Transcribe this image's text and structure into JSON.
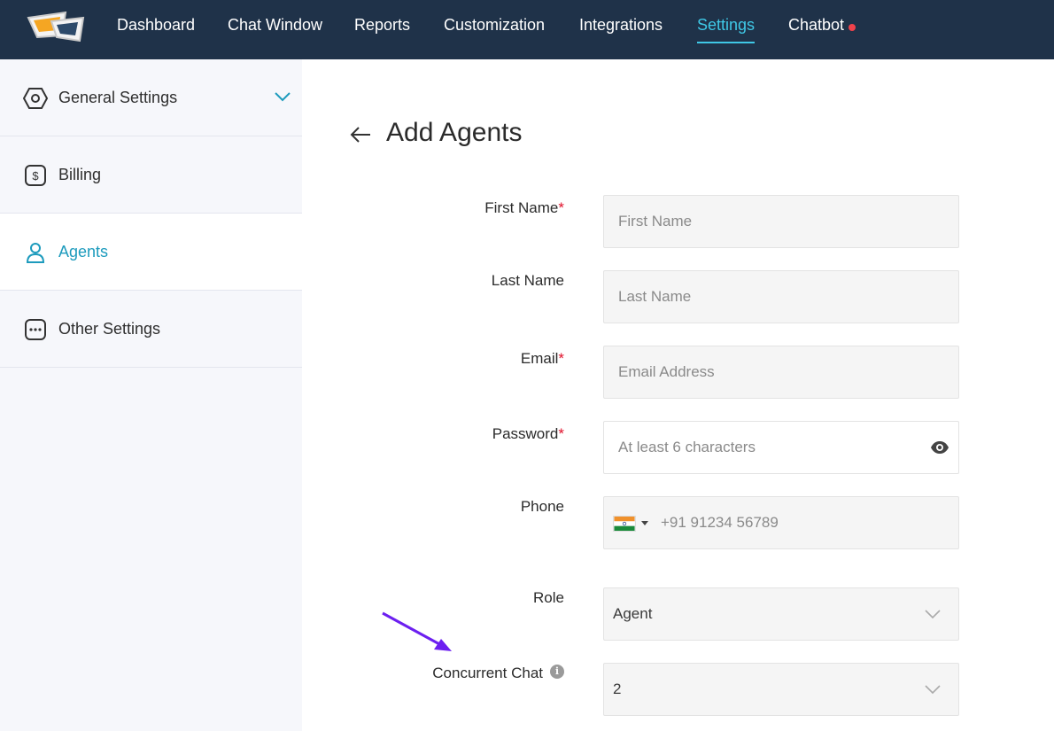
{
  "nav": {
    "items": [
      {
        "label": "Dashboard"
      },
      {
        "label": "Chat Window"
      },
      {
        "label": "Reports"
      },
      {
        "label": "Customization"
      },
      {
        "label": "Integrations"
      },
      {
        "label": "Settings",
        "active": true
      },
      {
        "label": "Chatbot",
        "notification_dot": true
      }
    ],
    "logo_icon": "chat-bubbles-logo"
  },
  "sidebar": {
    "items": [
      {
        "label": "General Settings",
        "icon": "hexagon-gear-icon",
        "expandable": true
      },
      {
        "label": "Billing",
        "icon": "dollar-icon"
      },
      {
        "label": "Agents",
        "icon": "user-icon",
        "active": true
      },
      {
        "label": "Other Settings",
        "icon": "more-dots-icon"
      }
    ]
  },
  "page": {
    "title": "Add Agents"
  },
  "form": {
    "first_name": {
      "label": "First Name",
      "required_mark": "*",
      "placeholder": "First Name"
    },
    "last_name": {
      "label": "Last Name",
      "placeholder": "Last Name"
    },
    "email": {
      "label": "Email",
      "required_mark": "*",
      "placeholder": "Email Address"
    },
    "password": {
      "label": "Password",
      "required_mark": "*",
      "placeholder": "At least 6 characters"
    },
    "phone": {
      "label": "Phone",
      "placeholder": "+91 91234 56789",
      "country_flag": "india-flag-icon"
    },
    "role": {
      "label": "Role",
      "value": "Agent"
    },
    "concurrent_chat": {
      "label": "Concurrent Chat",
      "value": "2",
      "info_glyph": "i"
    }
  },
  "colors": {
    "topbar": "#1f3249",
    "active_nav": "#3fc8e6",
    "active_sidebar": "#1d9bbd",
    "required": "#e0102a",
    "annotation_arrow": "#6c1ff0"
  }
}
